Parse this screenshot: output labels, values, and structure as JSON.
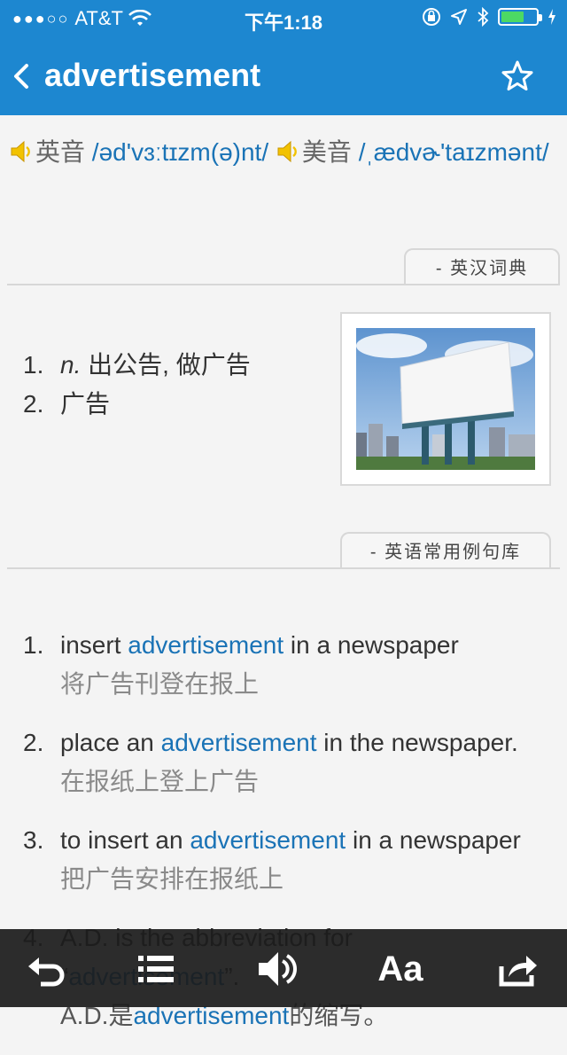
{
  "status_bar": {
    "signal": "●●●○○",
    "carrier": "AT&T",
    "time": "下午1:18"
  },
  "nav": {
    "title": "advertisement"
  },
  "pronunciation": {
    "uk_label": "英音",
    "uk_ipa": "/əd'vɜːtɪzm(ə)nt/",
    "us_label": "美音",
    "us_ipa": "/ˌædvɚ'taɪzmənt/"
  },
  "sections": {
    "dict_tab": "- 英汉词典",
    "examples_tab": "- 英语常用例句库"
  },
  "definitions": [
    {
      "num": "1.",
      "pos": "n.",
      "text": " 出公告, 做广告"
    },
    {
      "num": "2.",
      "pos": "",
      "text": "广告"
    }
  ],
  "examples": [
    {
      "num": "1.",
      "pre": "insert ",
      "kw": "advertisement",
      "post": " in a newspaper",
      "cn": "将广告刊登在报上"
    },
    {
      "num": "2.",
      "pre": "place an ",
      "kw": "advertisement",
      "post": " in the newspaper.",
      "cn": "在报纸上登上广告"
    },
    {
      "num": "3.",
      "pre": "to insert an ",
      "kw": "advertisement",
      "post": " in a newspaper",
      "cn": "把广告安排在报纸上"
    },
    {
      "num": "4.",
      "pre": "A.D. is the abbreviation for",
      "kw": "",
      "post": "",
      "cn": ""
    }
  ],
  "example4_line2": {
    "pre": "“",
    "kw": "advertisement",
    "post": "”."
  },
  "example4_cn": {
    "pre": "A.D.是",
    "kw": "advertisement",
    "post": "的缩写。"
  },
  "toolbar": {
    "font_label": "Aa"
  },
  "colors": {
    "header": "#1d87d0",
    "keyword": "#1a73b6",
    "toolbar": "#1c1c1c"
  }
}
